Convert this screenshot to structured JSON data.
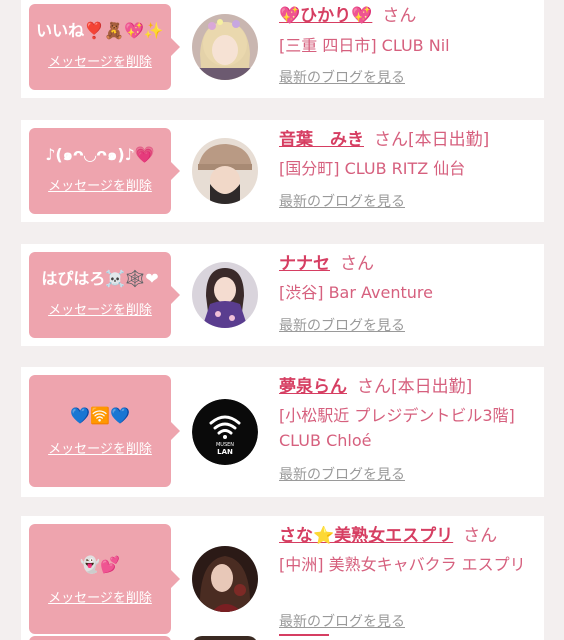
{
  "common": {
    "delete_label": "メッセージを削除",
    "san": "さん",
    "blog_link": "最新のブログを見る"
  },
  "colors": {
    "bubble": "#eea4ae",
    "name": "#d63e62",
    "text": "#d6607e",
    "link": "#9a9a9a",
    "background": "#f3efef"
  },
  "items": [
    {
      "message": "いいね❣️🧸💖✨",
      "name": "💖ひかり💖",
      "status": "",
      "shop": "[三重 四日市] CLUB Nil",
      "avatar": "photo-blonde-woman"
    },
    {
      "message": "♪(๑ᴖ◡ᴖ๑)♪💗",
      "name": "音葉　みき",
      "status": "[本日出勤]",
      "shop": "[国分町] CLUB RITZ 仙台",
      "avatar": "photo-woman-hat"
    },
    {
      "message": "はぴはろ☠️🕸️❤",
      "name": "ナナセ",
      "status": "",
      "shop": "[渋谷] Bar Aventure",
      "avatar": "photo-woman-purple-costume"
    },
    {
      "message": "💙🛜💙",
      "name": "夢泉らん",
      "status": "[本日出勤]",
      "shop": "[小松駅近 プレジデントビル3階] CLUB Chloé",
      "avatar": "musen-lan-logo",
      "avatar_text_top": "MUSEN",
      "avatar_text_bottom": "LAN"
    },
    {
      "message": "👻💕",
      "name": "さな⭐️美熟女エスプリ",
      "status": "",
      "shop": "[中洲] 美熟女キャバクラ エスプリ",
      "avatar": "photo-woman-dark-hair"
    }
  ]
}
